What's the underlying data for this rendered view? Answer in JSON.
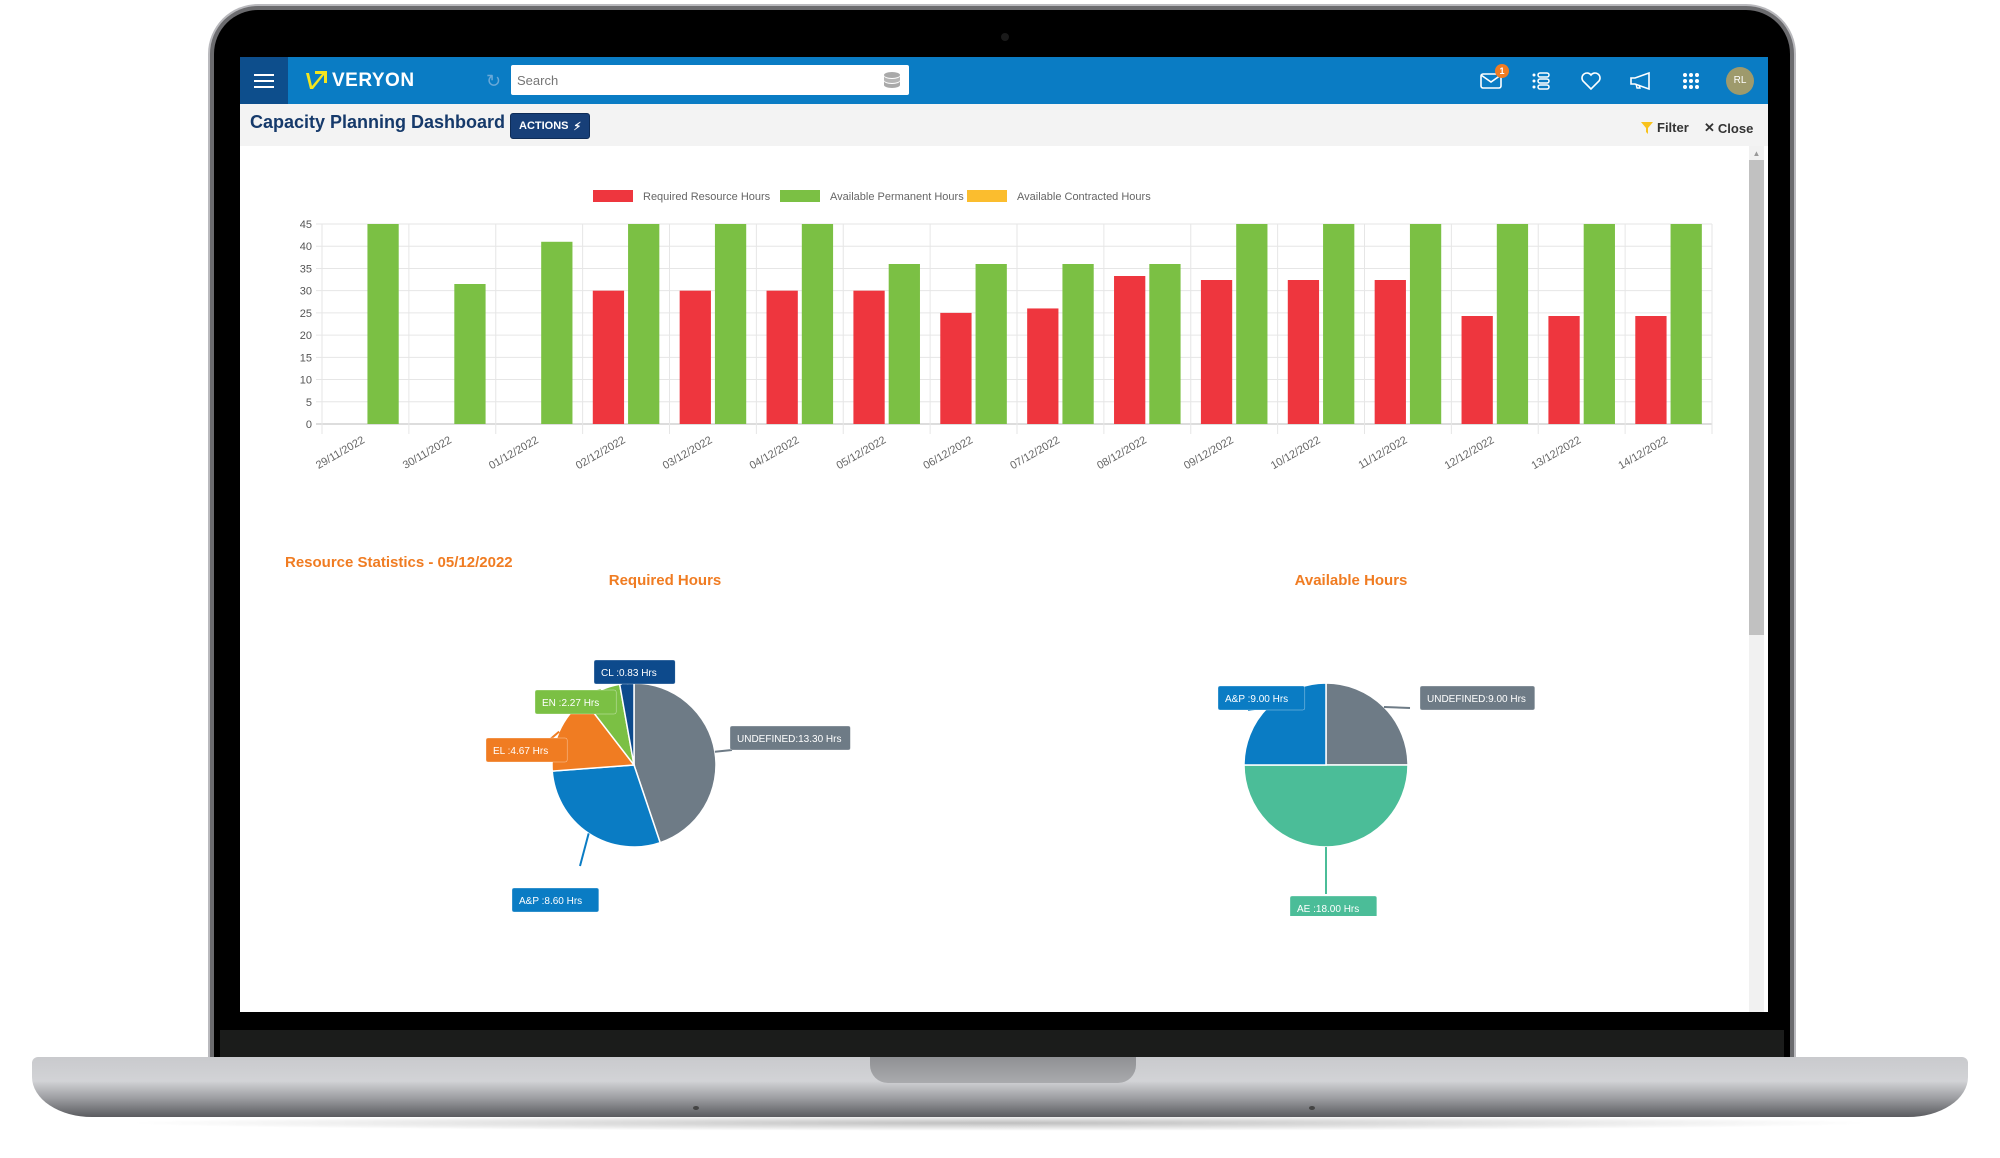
{
  "app": {
    "brand": "VERYON",
    "search_placeholder": "Search",
    "notification_count": "1",
    "avatar_initials": "RL",
    "icons": [
      "menu-icon",
      "refresh-icon",
      "database-icon",
      "mail-icon",
      "list-icon",
      "heart-icon",
      "megaphone-icon",
      "apps-grid-icon"
    ]
  },
  "page": {
    "title": "Capacity Planning Dashboard",
    "actions_label": "ACTIONS",
    "filter_label": "Filter",
    "close_label": "Close"
  },
  "stats": {
    "section_title": "Resource Statistics - 05/12/2022"
  },
  "colors": {
    "topbar": "#0a7cc4",
    "required": "#ee363e",
    "permanent": "#7bc044",
    "contracted": "#fbbd2e",
    "accent_orange": "#f07c22"
  },
  "chart_data": [
    {
      "type": "bar",
      "title": "",
      "xlabel": "",
      "ylabel": "",
      "ylim": [
        0,
        45
      ],
      "yticks": [
        "0",
        "5",
        "10",
        "15",
        "20",
        "25",
        "30",
        "35",
        "40",
        "45"
      ],
      "grid": true,
      "legend_position": "top-center",
      "categories": [
        "29/11/2022",
        "30/11/2022",
        "01/12/2022",
        "02/12/2022",
        "03/12/2022",
        "04/12/2022",
        "05/12/2022",
        "06/12/2022",
        "07/12/2022",
        "08/12/2022",
        "09/12/2022",
        "10/12/2022",
        "11/12/2022",
        "12/12/2022",
        "13/12/2022",
        "14/12/2022"
      ],
      "series": [
        {
          "name": "Required Resource Hours",
          "color": "#ee363e",
          "values": [
            0,
            0,
            0,
            30,
            30,
            30,
            30,
            25,
            26,
            33.3,
            32.4,
            32.4,
            32.4,
            24.3,
            24.3,
            24.3
          ]
        },
        {
          "name": "Available Permanent Hours",
          "color": "#7bc044",
          "values": [
            45,
            31.5,
            41,
            45,
            45,
            45,
            36,
            36,
            36,
            36,
            45,
            45,
            45,
            45,
            45,
            45
          ]
        },
        {
          "name": "Available Contracted Hours",
          "color": "#fbbd2e",
          "values": [
            0,
            0,
            0,
            0,
            0,
            0,
            0,
            0,
            0,
            0,
            0,
            0,
            0,
            0,
            0,
            0
          ]
        }
      ]
    },
    {
      "type": "pie",
      "title": "Required Hours",
      "slices": [
        {
          "label": "UNDEFINED:13.30 Hrs",
          "name": "UNDEFINED",
          "value": 13.3,
          "color": "#6e7b86"
        },
        {
          "label": "A&P :8.60 Hrs",
          "name": "A&P",
          "value": 8.6,
          "color": "#0a7cc4"
        },
        {
          "label": "EL :4.67 Hrs",
          "name": "EL",
          "value": 4.67,
          "color": "#f07c22"
        },
        {
          "label": "EN :2.27 Hrs",
          "name": "EN",
          "value": 2.27,
          "color": "#7bc044"
        },
        {
          "label": "CL :0.83 Hrs",
          "name": "CL",
          "value": 0.83,
          "color": "#0d4a8c"
        }
      ]
    },
    {
      "type": "pie",
      "title": "Available Hours",
      "slices": [
        {
          "label": "UNDEFINED:9.00 Hrs",
          "name": "UNDEFINED",
          "value": 9.0,
          "color": "#6e7b86"
        },
        {
          "label": "AE :18.00 Hrs",
          "name": "AE",
          "value": 18.0,
          "color": "#4bbd98"
        },
        {
          "label": "A&P :9.00 Hrs",
          "name": "A&P",
          "value": 9.0,
          "color": "#0a7cc4"
        }
      ]
    }
  ]
}
